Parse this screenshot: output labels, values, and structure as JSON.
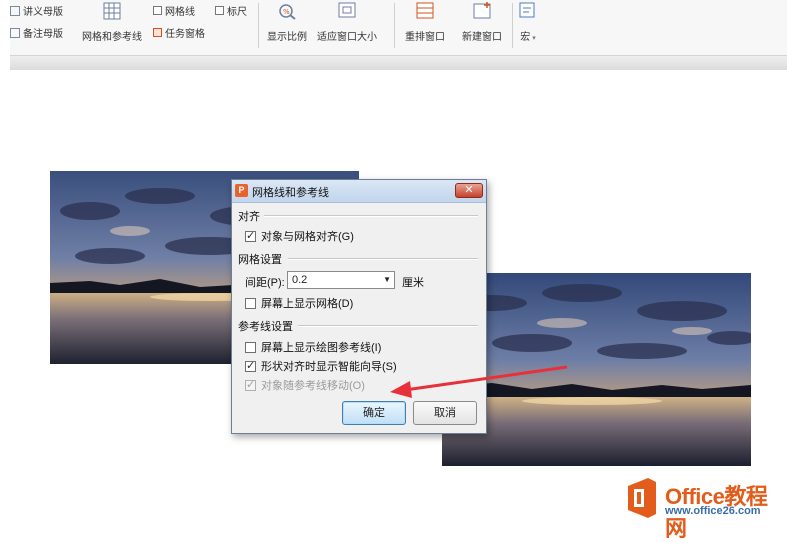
{
  "ribbon": {
    "left": {
      "item1": "讲义母版",
      "item2": "备注母版"
    },
    "grid_button": "网格和参考线",
    "checkboxes": {
      "gridlines": "网格线",
      "ruler": "标尺",
      "task_pane": "任务窗格"
    },
    "zoom_button": "显示比例",
    "fit_button": "适应窗口大小",
    "rearrange_button": "重排窗口",
    "new_window_button": "新建窗口",
    "macro_button": "宏"
  },
  "dialog": {
    "title": "网格线和参考线",
    "app_icon": "P",
    "close_glyph": "✕",
    "section_align": "对齐",
    "opt_snap": "对象与网格对齐(G)",
    "section_grid": "网格设置",
    "spacing_label": "间距(P):",
    "spacing_value": "0.2",
    "spacing_unit": "厘米",
    "opt_show_grid": "屏幕上显示网格(D)",
    "section_guides": "参考线设置",
    "opt_show_guides": "屏幕上显示绘图参考线(I)",
    "opt_smart_guides": "形状对齐时显示智能向导(S)",
    "opt_move_with_guides": "对象随参考线移动(O)",
    "ok_button": "确定",
    "cancel_button": "取消"
  },
  "watermark": {
    "brand": "Office教程网",
    "url": "www.office26.com"
  },
  "colors": {
    "arrow": "#e8303a",
    "brand_orange": "#e25d1c",
    "brand_blue": "#3a6ea5"
  },
  "icons": [
    "grid-icon",
    "zoom-icon",
    "fit-window-icon",
    "rearrange-window-icon",
    "new-window-icon",
    "macro-icon",
    "office-logo-icon"
  ]
}
